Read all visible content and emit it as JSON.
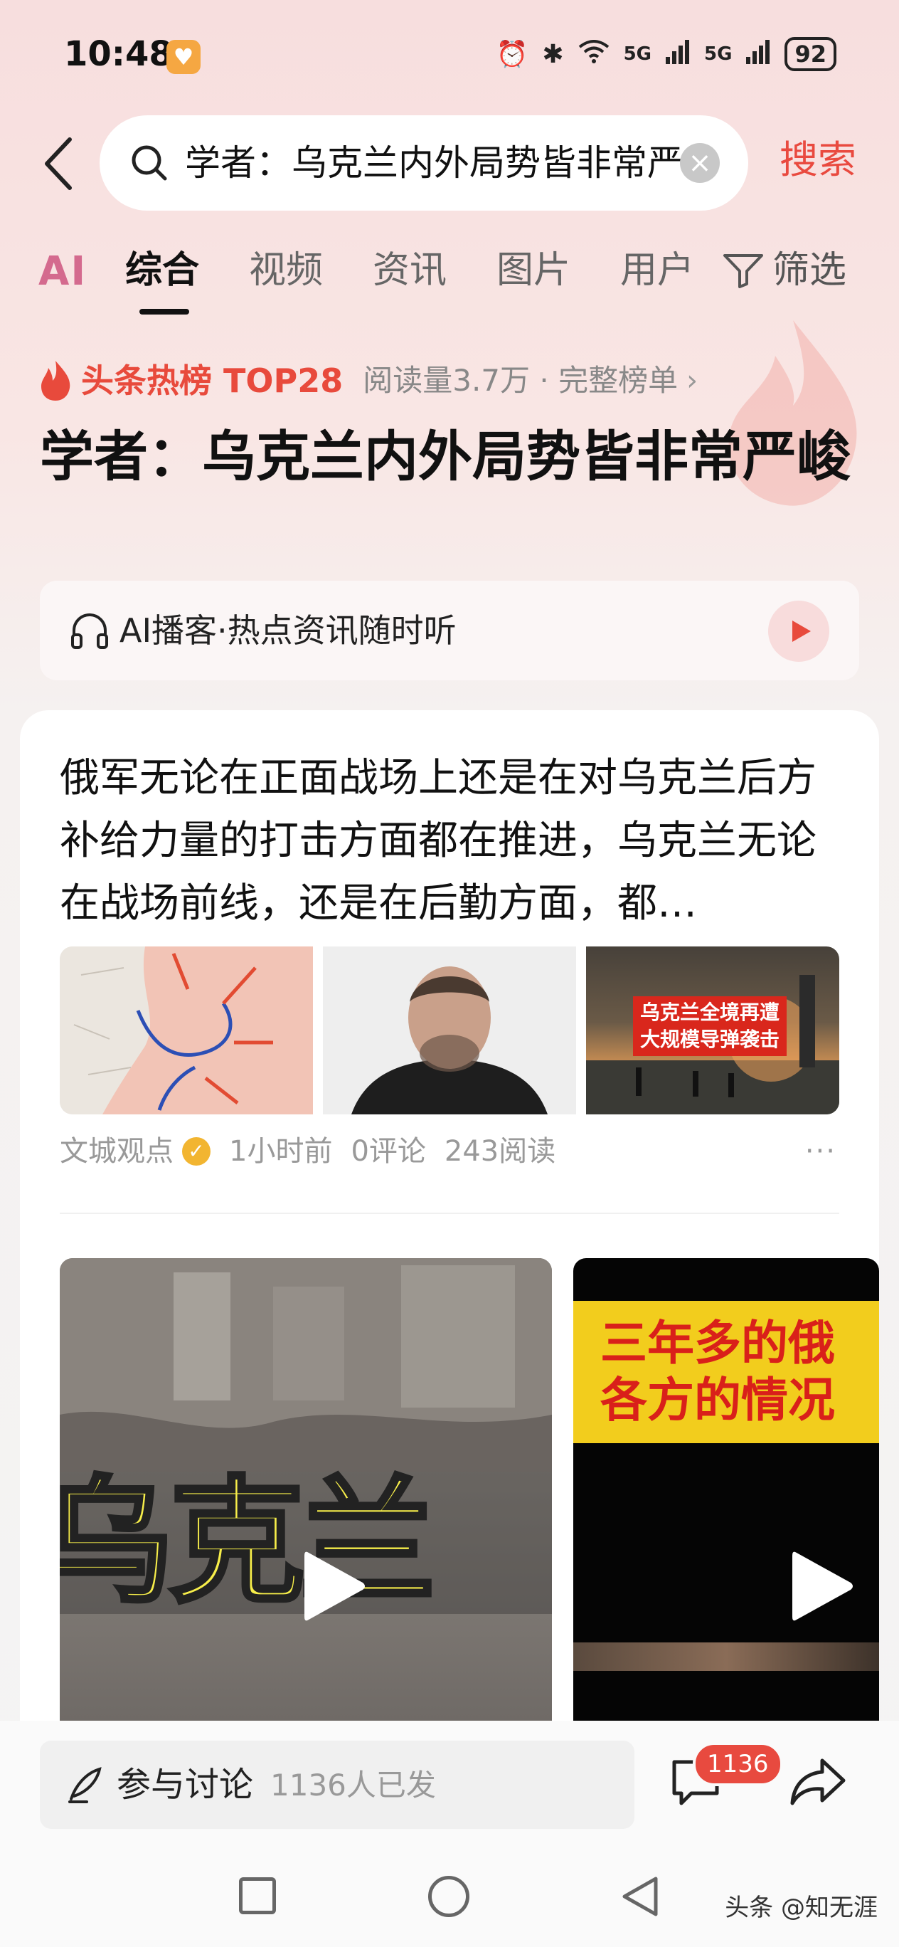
{
  "status_bar": {
    "time": "10:48",
    "heart_icon": "heart-icon",
    "signal_1": "5G",
    "signal_2": "5G",
    "battery": "92"
  },
  "search": {
    "query": "学者：乌克兰内外局势皆非常严峻",
    "submit_label": "搜索"
  },
  "tabs": {
    "ai": "AI",
    "items": [
      "综合",
      "视频",
      "资讯",
      "图片",
      "用户"
    ],
    "active_index": 0,
    "filter": "筛选"
  },
  "hot": {
    "label": "头条热榜 TOP28",
    "meta": "阅读量3.7万 · 完整榜单",
    "chevron": "›"
  },
  "headline": "学者：乌克兰内外局势皆非常严峻",
  "podcast": {
    "label": "AI播客·热点资讯随时听"
  },
  "article": {
    "text": "俄军无论在正面战场上还是在对乌克兰后方补给力量的打击方面都在推进，乌克兰无论在战场前线，还是在后勤方面，都…",
    "image_caption_line1": "乌克兰全境再遭",
    "image_caption_line2": "大规模导弹袭击",
    "author": "文城观点",
    "time": "1小时前",
    "comments": "0评论",
    "reads": "243阅读",
    "more": "···"
  },
  "videos": {
    "video1_text": "乌克兰",
    "video2_line1": "三年多的俄",
    "video2_line2": "各方的情况"
  },
  "bottom_bar": {
    "discuss_label": "参与讨论",
    "discuss_count": "1136人已发",
    "comment_badge": "1136"
  },
  "watermark": "头条 @知无涯",
  "colors": {
    "accent": "#e94a3f",
    "hot_red": "#e84a3c",
    "ai_pink": "#d46a8e",
    "video_yellow": "#f7ee4a"
  }
}
